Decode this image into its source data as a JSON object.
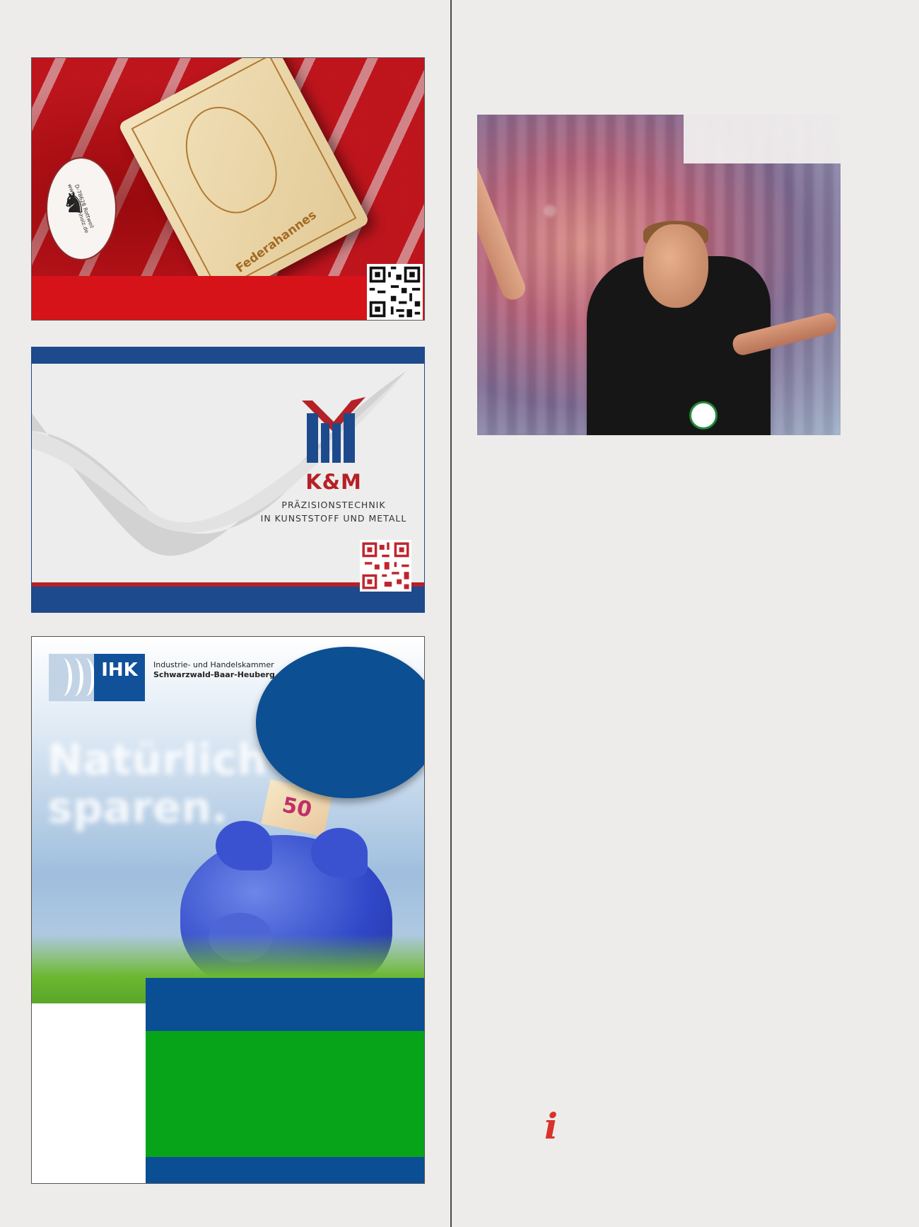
{
  "ads": {
    "holz": {
      "product_label": "Federahannes",
      "seal_text": "D-78628 Rottweil   www.baerenholz.de",
      "colors": {
        "band": "#d7131a",
        "background": "#b8141c"
      }
    },
    "km": {
      "brand_name": "K&M",
      "tagline_line1": "PRÄZISIONSTECHNIK",
      "tagline_line2": "IN KUNSTSTOFF UND METALL",
      "colors": {
        "primary": "#1d4a8c",
        "accent": "#b52126"
      }
    },
    "ihk": {
      "logo_text": "IHK",
      "org_line1": "Industrie- und Handelskammer",
      "org_line2": "Schwarzwald-Baar-Heuberg",
      "headline_line1": "Natürlich",
      "headline_line2": "sparen.",
      "banknote_value": "50",
      "colors": {
        "blue": "#0a4f93",
        "green": "#07a41a"
      }
    }
  },
  "photo": {
    "subject": "referee-photo"
  },
  "info_icon": {
    "glyph": "i",
    "color": "#d9322b"
  }
}
